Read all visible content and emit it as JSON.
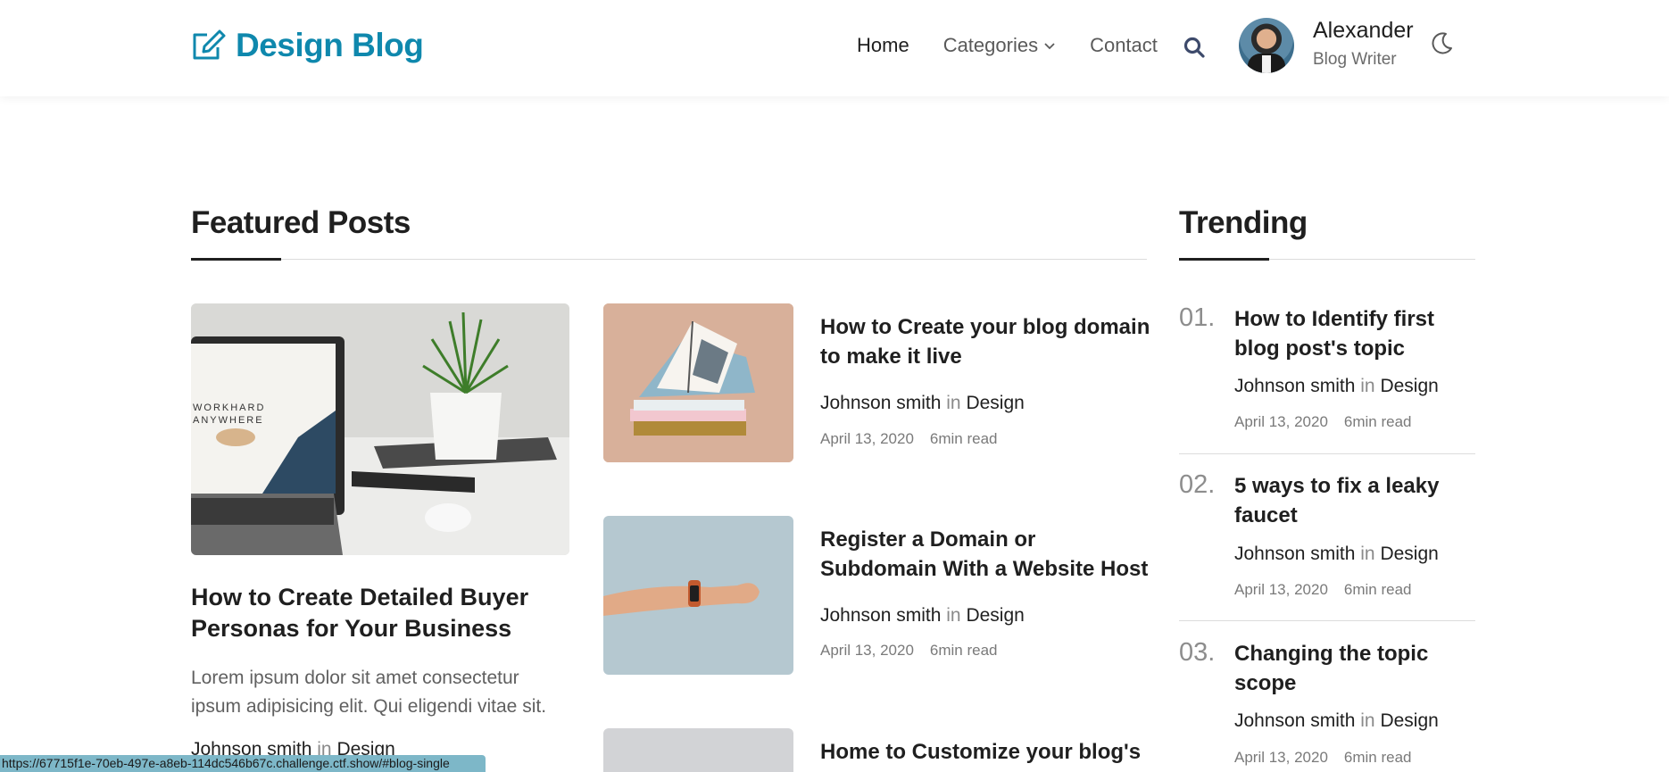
{
  "header": {
    "logo_text": "Design Blog",
    "nav": [
      {
        "label": "Home",
        "active": true
      },
      {
        "label": "Categories",
        "has_dropdown": true
      },
      {
        "label": "Contact"
      }
    ],
    "user": {
      "name": "Alexander",
      "role": "Blog Writer"
    },
    "icons": {
      "logo": "edit-icon",
      "search": "search-icon",
      "theme": "moon-icon",
      "dropdown": "chevron-down-icon"
    }
  },
  "featured": {
    "title": "Featured Posts",
    "main_post": {
      "title": "How to Create Detailed Buyer Personas for Your Business",
      "excerpt": "Lorem ipsum dolor sit amet consectetur ipsum adipisicing elit. Qui eligendi vitae sit.",
      "author": "Johnson smith",
      "in": "in",
      "category": "Design",
      "image_text": "WORKHARD ANYWHERE"
    },
    "posts": [
      {
        "title": "How to Create your blog domain to make it live",
        "author": "Johnson smith",
        "in": "in",
        "category": "Design",
        "date": "April 13, 2020",
        "read": "6min read"
      },
      {
        "title": "Register a Domain or Subdomain With a Website Host",
        "author": "Johnson smith",
        "in": "in",
        "category": "Design",
        "date": "April 13, 2020",
        "read": "6min read"
      },
      {
        "title": "Home to Customize your blog's"
      }
    ]
  },
  "trending": {
    "title": "Trending",
    "items": [
      {
        "num": "01.",
        "title": "How to Identify first blog post's topic",
        "author": "Johnson smith",
        "in": "in",
        "category": "Design",
        "date": "April 13, 2020",
        "read": "6min read"
      },
      {
        "num": "02.",
        "title": "5 ways to fix a leaky faucet",
        "author": "Johnson smith",
        "in": "in",
        "category": "Design",
        "date": "April 13, 2020",
        "read": "6min read"
      },
      {
        "num": "03.",
        "title": "Changing the topic scope",
        "author": "Johnson smith",
        "in": "in",
        "category": "Design",
        "date": "April 13, 2020",
        "read": "6min read"
      }
    ]
  },
  "status_bar": {
    "url": "https://67715f1e-70eb-497e-a8eb-114dc546b67c.challenge.ctf.show/#blog-single"
  },
  "colors": {
    "brand": "#0f88ad",
    "text": "#1f1f1f",
    "muted": "#7a7a7a",
    "status_bar": "#7db7c8"
  }
}
